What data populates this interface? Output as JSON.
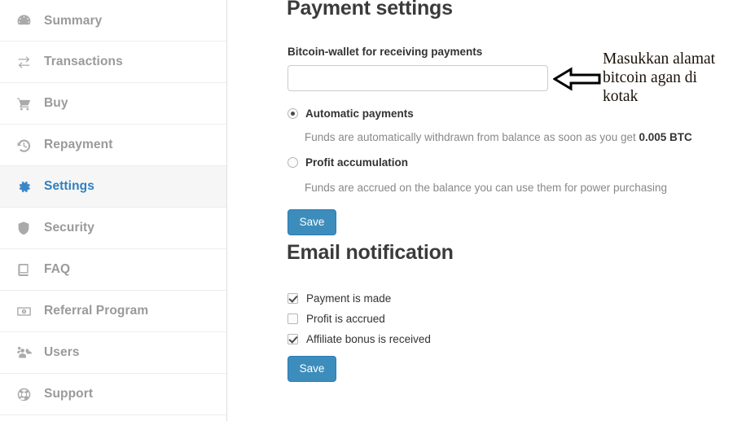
{
  "sidebar": {
    "items": [
      {
        "label": "Summary",
        "icon": "dashboard-icon",
        "active": false
      },
      {
        "label": "Transactions",
        "icon": "exchange-icon",
        "active": false
      },
      {
        "label": "Buy",
        "icon": "cart-icon",
        "active": false
      },
      {
        "label": "Repayment",
        "icon": "history-icon",
        "active": false
      },
      {
        "label": "Settings",
        "icon": "gear-icon",
        "active": true
      },
      {
        "label": "Security",
        "icon": "shield-icon",
        "active": false
      },
      {
        "label": "FAQ",
        "icon": "book-icon",
        "active": false
      },
      {
        "label": "Referral Program",
        "icon": "banknote-icon",
        "active": false
      },
      {
        "label": "Users",
        "icon": "users-icon",
        "active": false
      },
      {
        "label": "Support",
        "icon": "lifering-icon",
        "active": false
      }
    ],
    "active_color": "#2f7fc1",
    "inactive_color": "#9a9a9a",
    "active_bg": "#f6f6f6"
  },
  "payment": {
    "title": "Payment settings",
    "wallet_label": "Bitcoin-wallet for receiving payments",
    "wallet_value": "",
    "wallet_placeholder": "",
    "options": [
      {
        "label": "Automatic payments",
        "selected": true,
        "help_prefix": "Funds are automatically withdrawn from balance as soon as you get ",
        "help_strong": "0.005 BTC",
        "help_suffix": ""
      },
      {
        "label": "Profit accumulation",
        "selected": false,
        "help_prefix": "Funds are accrued on the balance you can use them for power purchasing",
        "help_strong": "",
        "help_suffix": ""
      }
    ],
    "save_label": "Save"
  },
  "email": {
    "title": "Email notification",
    "checkboxes": [
      {
        "label": "Payment is made",
        "checked": true
      },
      {
        "label": "Profit is accrued",
        "checked": false
      },
      {
        "label": "Affiliate bonus is received",
        "checked": true
      }
    ],
    "save_label": "Save"
  },
  "annotation": {
    "text": "Masukkan alamat bitcoin agan di kotak",
    "arrow_direction": "left"
  },
  "theme": {
    "button_blue": "#3c8dbc",
    "heading_color": "#3b3b3b",
    "help_text_color": "#888888"
  }
}
